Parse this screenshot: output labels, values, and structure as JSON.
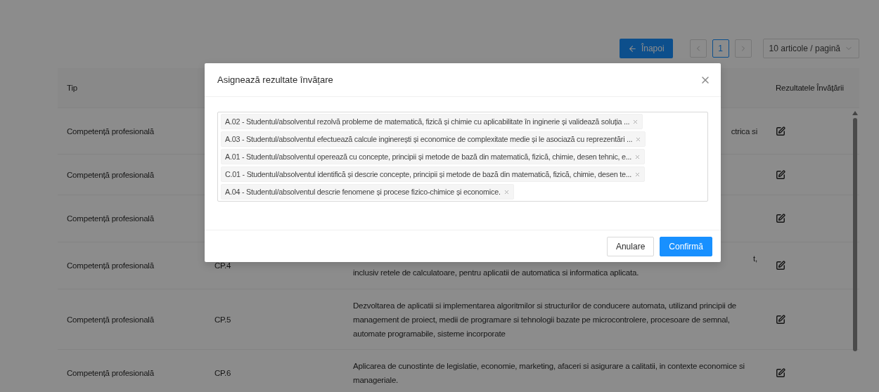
{
  "toolbar": {
    "back_button": "Înapoi",
    "pages": [
      {
        "label": "1",
        "selected": true
      }
    ],
    "page_size": "10 articole / pagină"
  },
  "table": {
    "header": {
      "tip": "Tip",
      "outcomes": "Rezultatele Învățării"
    },
    "rows": [
      {
        "tip": "Competență profesională",
        "description": [
          {
            "text": "ctrica si",
            "covered": true
          }
        ]
      },
      {
        "tip": "Competență profesională"
      },
      {
        "tip": "Competență profesională"
      },
      {
        "tip": "Competență profesională",
        "code": "CP.4",
        "description": [
          {
            "text": "t,",
            "covered": true
          },
          {
            "text": "inclusiv retele de calculatoare, pentru aplicatii de automatica si informatica aplicata.",
            "covered": false
          }
        ]
      },
      {
        "tip": "Competență profesională",
        "code": "CP.5",
        "description": [
          {
            "text": "Dezvoltarea de aplicatii si implementarea algoritmilor si structurilor de conducere automata, utilizand principii de management de proiect, medii de programare si tehnologii bazate pe microcontrolere, procesoare de semnal, automate programabile, sisteme incorporate",
            "covered": false
          }
        ]
      },
      {
        "tip": "Competență profesională",
        "code": "CP.6",
        "description": [
          {
            "text": "Aplicarea de cunostinte de legislatie, economie, marketing, afaceri si asigurare a calitatii, in contexte economice si manageriale.",
            "covered": false
          }
        ]
      }
    ]
  },
  "modal": {
    "title": "Asignează rezultate învățare",
    "tags": [
      "A.02 - Studentul/absolventul rezolvă probleme de matematică, fizică și chimie cu aplicabilitate în inginerie și validează soluția ...",
      "A.03 - Studentul/absolventul efectuează calcule inginerești și economice de complexitate medie și le asociază cu reprezentări ...",
      "A.01 - Studentul/absolventul operează cu concepte, principii și metode de bază din matematică, fizică, chimie, desen tehnic, e...",
      "C.01 - Studentul/absolventul identifică și descrie concepte, principii și metode de bază din matematică, fizică, chimie, desen te...",
      "A.04 - Studentul/absolventul descrie fenomene și procese fizico-chimice și economice."
    ],
    "cancel_button": "Anulare",
    "confirm_button": "Confirmă"
  }
}
